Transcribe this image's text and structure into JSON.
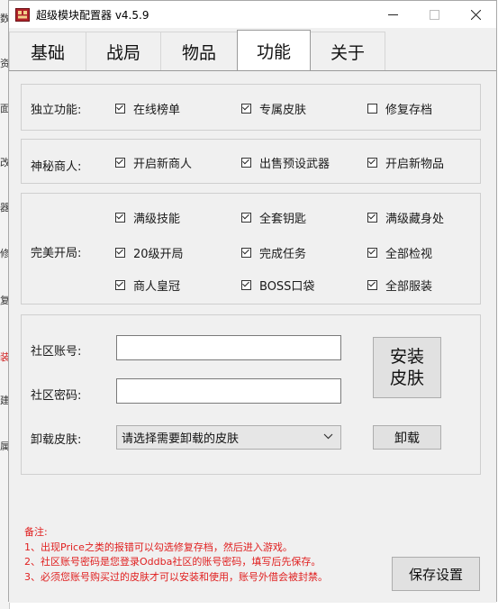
{
  "background_window": {
    "fragments": [
      "数",
      "资",
      "面",
      "改",
      "器",
      "修",
      "复",
      "装",
      "建",
      "属"
    ]
  },
  "window": {
    "title": "超级模块配置器 v4.5.9",
    "controls": {
      "minimize": "—",
      "maximize": "☐",
      "close": "✕"
    }
  },
  "tabs": [
    {
      "label": "基础",
      "active": false
    },
    {
      "label": "战局",
      "active": false
    },
    {
      "label": "物品",
      "active": false
    },
    {
      "label": "功能",
      "active": true
    },
    {
      "label": "关于",
      "active": false
    }
  ],
  "groups": {
    "standalone": {
      "label": "独立功能:",
      "items": [
        {
          "label": "在线榜单",
          "checked": true
        },
        {
          "label": "专属皮肤",
          "checked": true
        },
        {
          "label": "修复存档",
          "checked": false
        }
      ]
    },
    "merchant": {
      "label": "神秘商人:",
      "items": [
        {
          "label": "开启新商人",
          "checked": true
        },
        {
          "label": "出售预设武器",
          "checked": true
        },
        {
          "label": "开启新物品",
          "checked": true
        }
      ]
    },
    "perfect_start": {
      "label": "完美开局:",
      "items": [
        {
          "label": "满级技能",
          "checked": true
        },
        {
          "label": "全套钥匙",
          "checked": true
        },
        {
          "label": "满级藏身处",
          "checked": true
        },
        {
          "label": "20级开局",
          "checked": true
        },
        {
          "label": "完成任务",
          "checked": true
        },
        {
          "label": "全部检视",
          "checked": true
        },
        {
          "label": "商人皇冠",
          "checked": true
        },
        {
          "label": "BOSS口袋",
          "checked": true
        },
        {
          "label": "全部服装",
          "checked": true
        }
      ]
    }
  },
  "skin": {
    "account_label": "社区账号:",
    "account_value": "",
    "password_label": "社区密码:",
    "password_value": "",
    "install_label_1": "安装",
    "install_label_2": "皮肤",
    "uninstall_label": "卸载皮肤:",
    "uninstall_select": "请选择需要卸载的皮肤",
    "uninstall_button": "卸载"
  },
  "notes": {
    "title": "备注:",
    "lines": [
      "1、出现Price之类的报错可以勾选修复存档，然后进入游戏。",
      "2、社区账号密码是您登录Oddba社区的账号密码，填写后先保存。",
      "3、必须您账号购买过的皮肤才可以安装和使用，账号外借会被封禁。"
    ]
  },
  "save_button": "保存设置",
  "colors": {
    "note_text": "#e02020",
    "window_bg": "#f0f0f0",
    "app_icon": "#b0232a"
  },
  "icons": {
    "app": "app-icon",
    "checkbox_checked": "check-icon",
    "dropdown": "chevron-down-icon"
  }
}
